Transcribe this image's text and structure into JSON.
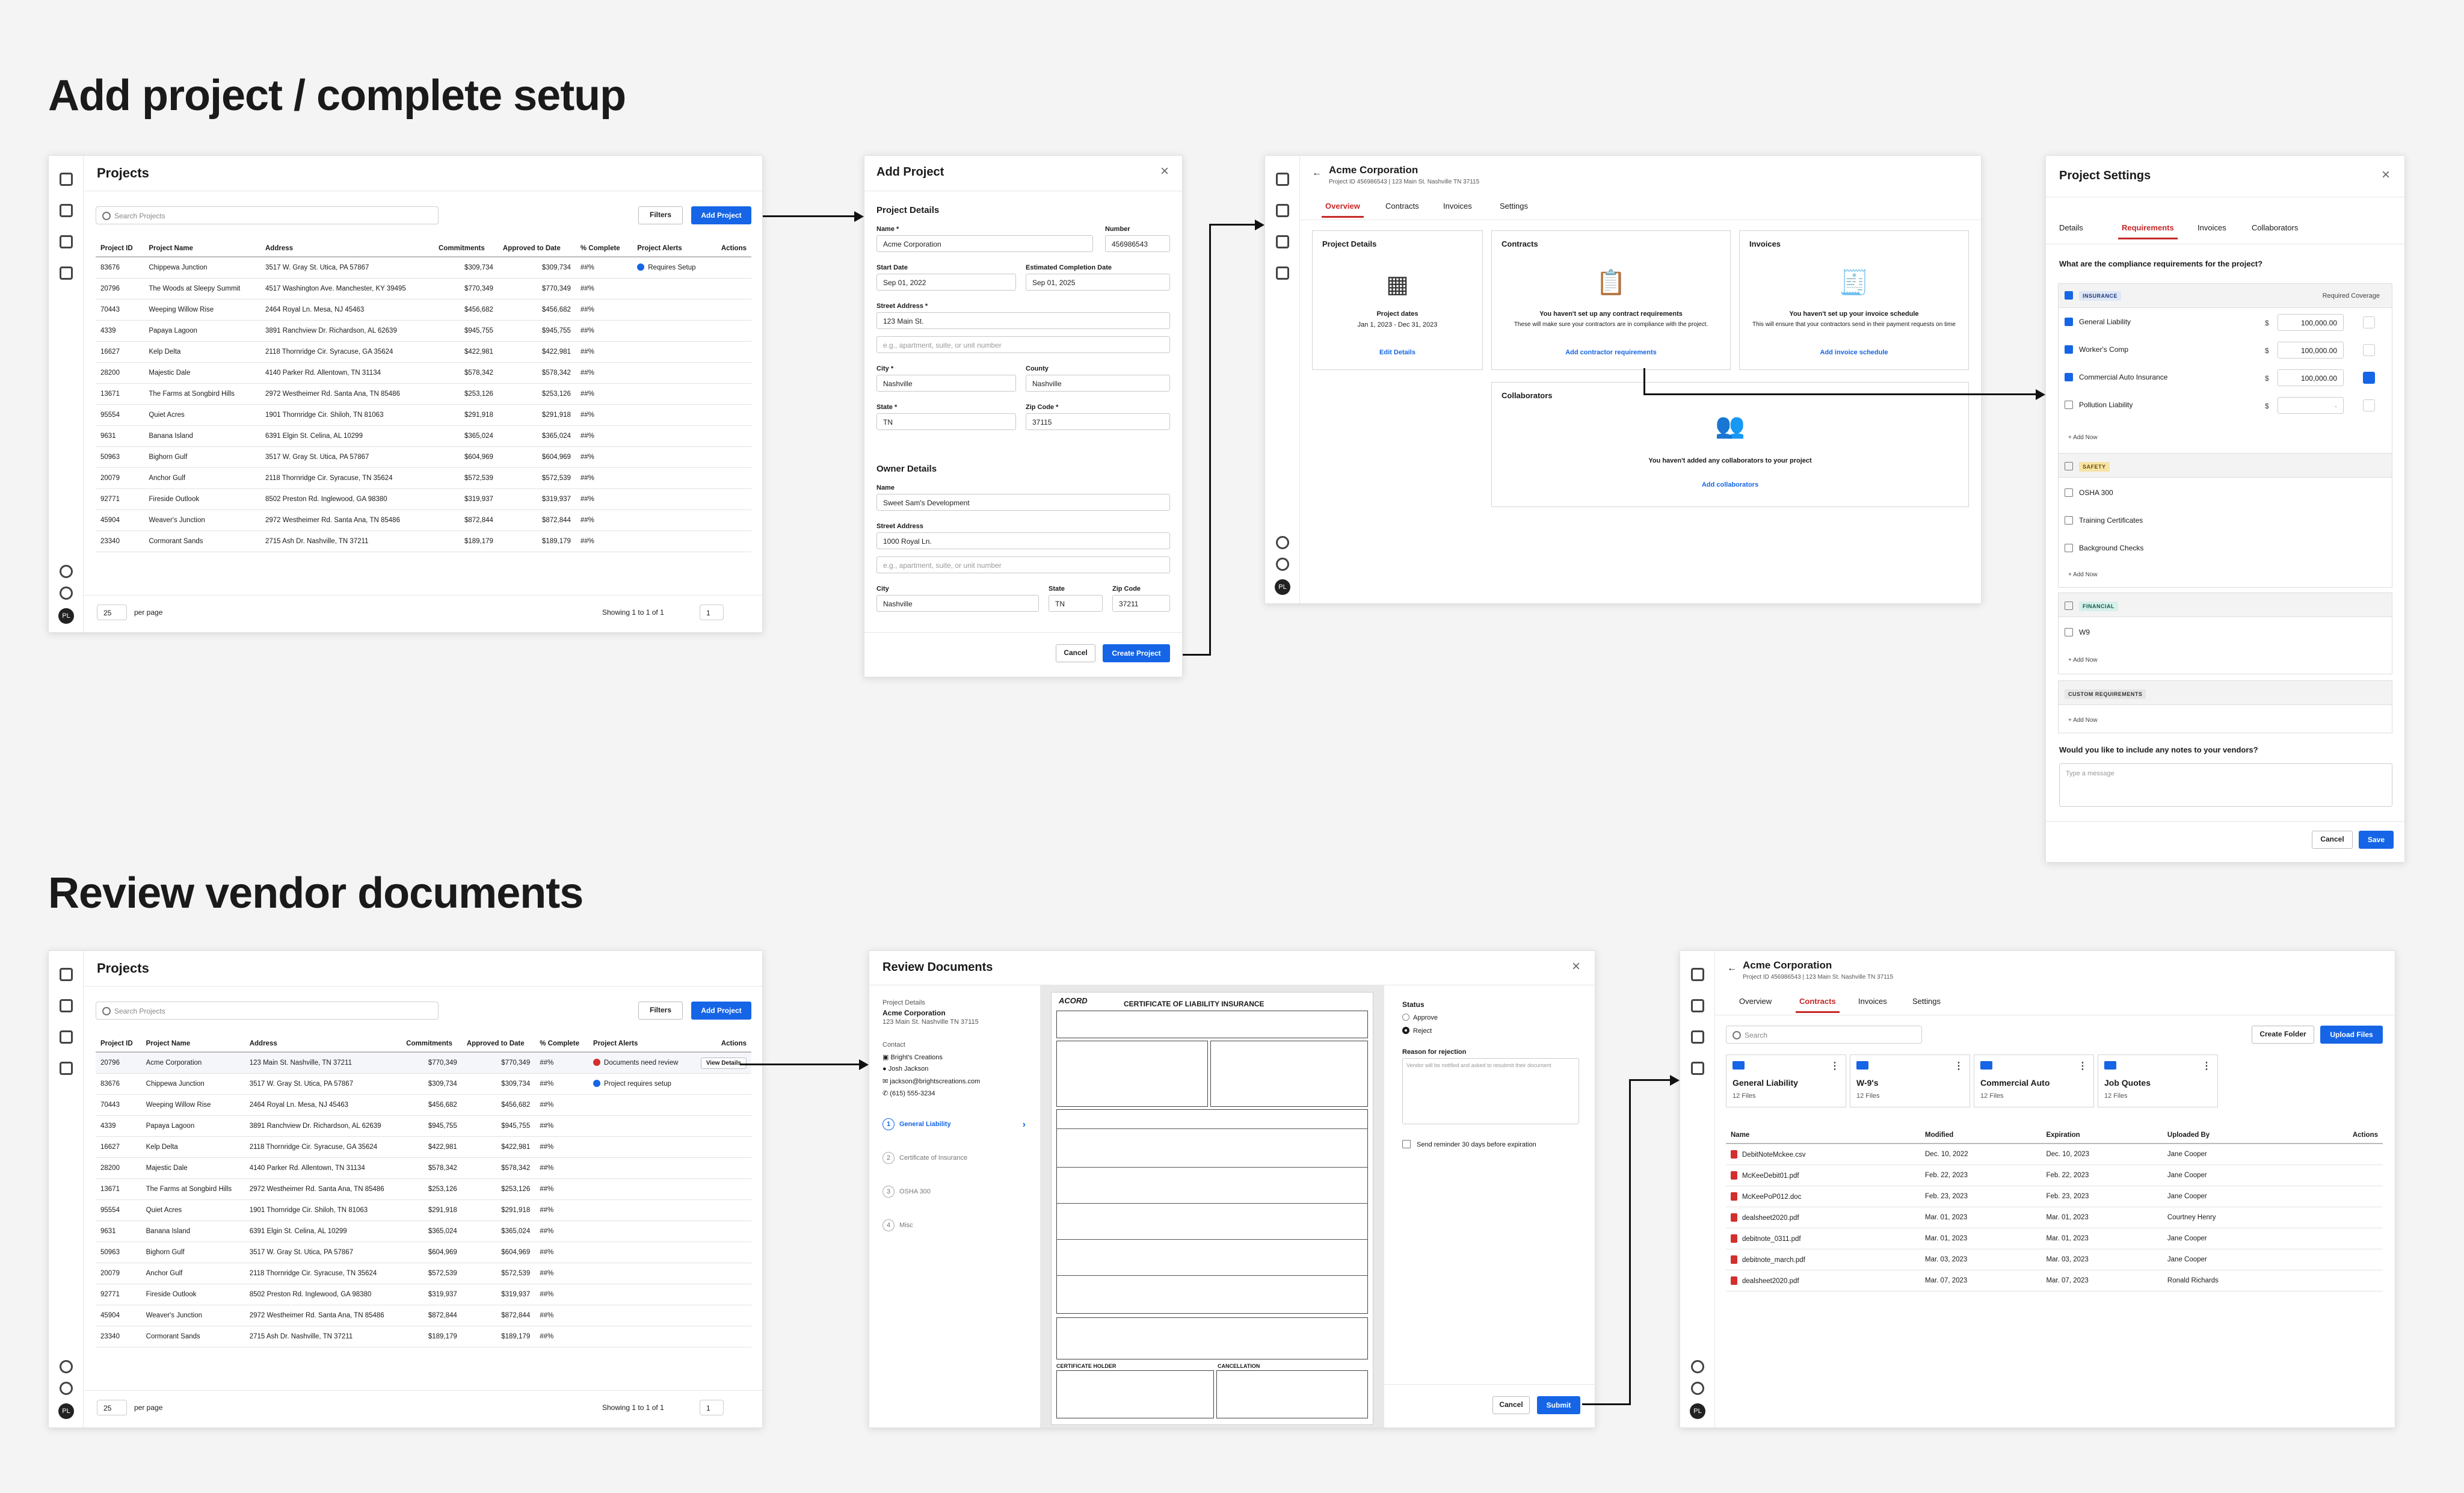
{
  "sections": {
    "setup_title": "Add project / complete setup",
    "review_title": "Review vendor documents"
  },
  "projects": {
    "title": "Projects",
    "search_placeholder": "Search Projects",
    "filters_label": "Filters",
    "add_label": "Add Project",
    "columns": [
      "Project ID",
      "Project Name",
      "Address",
      "Commitments",
      "Approved to Date",
      "% Complete",
      "Project Alerts",
      "Actions"
    ],
    "rows": [
      [
        "83676",
        "Chippewa Junction",
        "3517 W. Gray St. Utica, PA 57867",
        "$309,734",
        "$309,734",
        "##%",
        "Requires Setup"
      ],
      [
        "20796",
        "The Woods at Sleepy Summit",
        "4517 Washington Ave. Manchester, KY 39495",
        "$770,349",
        "$770,349",
        "##%",
        ""
      ],
      [
        "70443",
        "Weeping Willow Rise",
        "2464 Royal Ln. Mesa, NJ 45463",
        "$456,682",
        "$456,682",
        "##%",
        ""
      ],
      [
        "4339",
        "Papaya Lagoon",
        "3891 Ranchview Dr. Richardson, AL 62639",
        "$945,755",
        "$945,755",
        "##%",
        ""
      ],
      [
        "16627",
        "Kelp Delta",
        "2118 Thornridge Cir. Syracuse, GA 35624",
        "$422,981",
        "$422,981",
        "##%",
        ""
      ],
      [
        "28200",
        "Majestic Dale",
        "4140 Parker Rd. Allentown, TN 31134",
        "$578,342",
        "$578,342",
        "##%",
        ""
      ],
      [
        "13671",
        "The Farms at Songbird Hills",
        "2972 Westheimer Rd. Santa Ana, TN 85486",
        "$253,126",
        "$253,126",
        "##%",
        ""
      ],
      [
        "95554",
        "Quiet Acres",
        "1901 Thornridge Cir. Shiloh, TN 81063",
        "$291,918",
        "$291,918",
        "##%",
        ""
      ],
      [
        "9631",
        "Banana Island",
        "6391 Elgin St. Celina, AL 10299",
        "$365,024",
        "$365,024",
        "##%",
        ""
      ],
      [
        "50963",
        "Bighorn Gulf",
        "3517 W. Gray St. Utica, PA 57867",
        "$604,969",
        "$604,969",
        "##%",
        ""
      ],
      [
        "20079",
        "Anchor Gulf",
        "2118 Thornridge Cir. Syracuse, TN 35624",
        "$572,539",
        "$572,539",
        "##%",
        ""
      ],
      [
        "92771",
        "Fireside Outlook",
        "8502 Preston Rd. Inglewood, GA 98380",
        "$319,937",
        "$319,937",
        "##%",
        ""
      ],
      [
        "45904",
        "Weaver's Junction",
        "2972 Westheimer Rd. Santa Ana, TN 85486",
        "$872,844",
        "$872,844",
        "##%",
        ""
      ],
      [
        "23340",
        "Cormorant Sands",
        "2715 Ash Dr. Nashville, TN 37211",
        "$189,179",
        "$189,179",
        "##%",
        ""
      ]
    ],
    "rows2": [
      [
        "20796",
        "Acme Corporation",
        "123 Main St. Nashville, TN 37211",
        "$770,349",
        "$770,349",
        "##%",
        "Documents need review"
      ],
      [
        "83676",
        "Chippewa Junction",
        "3517 W. Gray St. Utica, PA 57867",
        "$309,734",
        "$309,734",
        "##%",
        "Project requires setup"
      ],
      [
        "70443",
        "Weeping Willow Rise",
        "2464 Royal Ln. Mesa, NJ 45463",
        "$456,682",
        "$456,682",
        "##%",
        ""
      ],
      [
        "4339",
        "Papaya Lagoon",
        "3891 Ranchview Dr. Richardson, AL 62639",
        "$945,755",
        "$945,755",
        "##%",
        ""
      ],
      [
        "16627",
        "Kelp Delta",
        "2118 Thornridge Cir. Syracuse, GA 35624",
        "$422,981",
        "$422,981",
        "##%",
        ""
      ],
      [
        "28200",
        "Majestic Dale",
        "4140 Parker Rd. Allentown, TN 31134",
        "$578,342",
        "$578,342",
        "##%",
        ""
      ],
      [
        "13671",
        "The Farms at Songbird Hills",
        "2972 Westheimer Rd. Santa Ana, TN 85486",
        "$253,126",
        "$253,126",
        "##%",
        ""
      ],
      [
        "95554",
        "Quiet Acres",
        "1901 Thornridge Cir. Shiloh, TN 81063",
        "$291,918",
        "$291,918",
        "##%",
        ""
      ],
      [
        "9631",
        "Banana Island",
        "6391 Elgin St. Celina, AL 10299",
        "$365,024",
        "$365,024",
        "##%",
        ""
      ],
      [
        "50963",
        "Bighorn Gulf",
        "3517 W. Gray St. Utica, PA 57867",
        "$604,969",
        "$604,969",
        "##%",
        ""
      ],
      [
        "20079",
        "Anchor Gulf",
        "2118 Thornridge Cir. Syracuse, TN 35624",
        "$572,539",
        "$572,539",
        "##%",
        ""
      ],
      [
        "92771",
        "Fireside Outlook",
        "8502 Preston Rd. Inglewood, GA 98380",
        "$319,937",
        "$319,937",
        "##%",
        ""
      ],
      [
        "45904",
        "Weaver's Junction",
        "2972 Westheimer Rd. Santa Ana, TN 85486",
        "$872,844",
        "$872,844",
        "##%",
        ""
      ],
      [
        "23340",
        "Cormorant Sands",
        "2715 Ash Dr. Nashville, TN 37211",
        "$189,179",
        "$189,179",
        "##%",
        ""
      ]
    ],
    "view_details": "View Details",
    "per_page_value": "25",
    "per_page_label": "per page",
    "showing": "Showing 1 to 1 of 1",
    "page_value": "1",
    "avatar": "PL"
  },
  "add_project": {
    "title": "Add Project",
    "details_title": "Project Details",
    "name_label": "Name *",
    "name_value": "Acme Corporation",
    "number_label": "Number",
    "number_value": "456986543",
    "start_label": "Start Date",
    "start_value": "Sep 01, 2022",
    "end_label": "Estimated Completion Date",
    "end_value": "Sep 01, 2025",
    "street_label": "Street Address *",
    "street_value": "123 Main St.",
    "street2_placeholder": "e.g., apartment, suite, or unit number",
    "city_label": "City *",
    "city_value": "Nashville",
    "county_label": "County",
    "county_value": "Nashville",
    "state_label": "State *",
    "state_value": "TN",
    "zip_label": "Zip Code *",
    "zip_value": "37115",
    "owner_title": "Owner Details",
    "owner_name_label": "Name",
    "owner_name_value": "Sweet Sam's Development",
    "owner_street_label": "Street Address",
    "owner_street_value": "1000 Royal Ln.",
    "owner_street2_placeholder": "e.g., apartment, suite, or unit number",
    "owner_city_label": "City",
    "owner_city_value": "Nashville",
    "owner_state_label": "State",
    "owner_state_value": "TN",
    "owner_zip_label": "Zip Code",
    "owner_zip_value": "37211",
    "cancel": "Cancel",
    "create": "Create Project"
  },
  "overview": {
    "company": "Acme Corporation",
    "subtitle": "Project ID 456986543 | 123 Main St. Nashville TN 37115",
    "tabs": [
      "Overview",
      "Contracts",
      "Invoices",
      "Settings"
    ],
    "project_details": "Project Details",
    "project_dates": "Project dates",
    "dates_value": "Jan 1, 2023 - Dec 31, 2023",
    "edit_details": "Edit Details",
    "contracts": "Contracts",
    "contracts_empty": "You haven't set up any contract requirements",
    "contracts_sub": "These will make sure your contractors are in compliance with the project.",
    "contracts_link": "Add contractor requirements",
    "invoices": "Invoices",
    "invoices_empty": "You haven't set up your invoice schedule",
    "invoices_sub": "This will ensure that your contractors send in their payment requests on time",
    "invoices_link": "Add invoice schedule",
    "collaborators": "Collaborators",
    "collab_empty": "You haven't added any collaborators to your project",
    "collab_link": "Add collaborators"
  },
  "settings": {
    "title": "Project Settings",
    "tabs": [
      "Details",
      "Requirements",
      "Invoices",
      "Collaborators"
    ],
    "question": "What are the compliance requirements for the project?",
    "insurance": "INSURANCE",
    "required_coverage": "Required Coverage",
    "insurance_items": [
      {
        "name": "General Liability",
        "amount": "100,000.00"
      },
      {
        "name": "Worker's Comp",
        "amount": "100,000.00"
      },
      {
        "name": "Commercial Auto Insurance",
        "amount": "100,000.00"
      },
      {
        "name": "Pollution Liability",
        "amount": "-"
      }
    ],
    "add_now": "+ Add Now",
    "safety": "SAFETY",
    "safety_items": [
      "OSHA 300",
      "Training Certificates",
      "Background Checks"
    ],
    "financial": "FINANCIAL",
    "financial_items": [
      "W9"
    ],
    "custom": "CUSTOM REQUIREMENTS",
    "notes_question": "Would you like to include any notes to your vendors?",
    "notes_placeholder": "Type a message",
    "cancel": "Cancel",
    "save": "Save"
  },
  "review": {
    "title": "Review Documents",
    "pd_label": "Project Details",
    "company": "Acme Corporation",
    "address": "123 Main St. Nashville TN 37115",
    "contact_label": "Contact",
    "contact_company": "Bright's Creations",
    "contact_name": "Josh Jackson",
    "contact_email": "jackson@brightscreations.com",
    "contact_phone": "(615) 555-3234",
    "steps": [
      "General Liability",
      "Certificate of Insurance",
      "OSHA 300",
      "Misc"
    ],
    "step_nums": [
      "1",
      "2",
      "3",
      "4"
    ],
    "doc_title": "CERTIFICATE OF LIABILITY INSURANCE",
    "doc_logo": "ACORD",
    "doc_holder": "CERTIFICATE HOLDER",
    "doc_cancel": "CANCELLATION",
    "status": "Status",
    "approve": "Approve",
    "reject": "Reject",
    "reason_label": "Reason for rejection",
    "reason_placeholder": "Vendor will be notified and asked to resubmit their document",
    "reminder": "Send reminder 30 days before expiration",
    "cancel": "Cancel",
    "submit": "Submit"
  },
  "contracts": {
    "company": "Acme Corporation",
    "subtitle": "Project ID 456986543 | 123 Main St. Nashville TN 37115",
    "tabs": [
      "Overview",
      "Contracts",
      "Invoices",
      "Settings"
    ],
    "search_placeholder": "Search",
    "create_folder": "Create Folder",
    "upload": "Upload Files",
    "folders": [
      {
        "name": "General Liability",
        "count": "12 Files"
      },
      {
        "name": "W-9's",
        "count": "12 Files"
      },
      {
        "name": "Commercial Auto",
        "count": "12 Files"
      },
      {
        "name": "Job Quotes",
        "count": "12 Files"
      }
    ],
    "columns": [
      "Name",
      "Modified",
      "Expiration",
      "Uploaded By",
      "Actions"
    ],
    "files": [
      [
        "DebitNoteMckee.csv",
        "Dec. 10, 2022",
        "Dec. 10, 2023",
        "Jane Cooper"
      ],
      [
        "McKeeDebit01.pdf",
        "Feb. 22, 2023",
        "Feb. 22, 2023",
        "Jane Cooper"
      ],
      [
        "McKeePoP012.doc",
        "Feb. 23, 2023",
        "Feb. 23, 2023",
        "Jane Cooper"
      ],
      [
        "dealsheet2020.pdf",
        "Mar. 01, 2023",
        "Mar. 01, 2023",
        "Courtney Henry"
      ],
      [
        "debitnote_0311.pdf",
        "Mar. 01, 2023",
        "Mar. 01, 2023",
        "Jane Cooper"
      ],
      [
        "debitnote_march.pdf",
        "Mar. 03, 2023",
        "Mar. 03, 2023",
        "Jane Cooper"
      ],
      [
        "dealsheet2020.pdf",
        "Mar. 07, 2023",
        "Mar. 07, 2023",
        "Ronald Richards"
      ]
    ]
  },
  "colors": {
    "accent": "#1565e6",
    "active_tab": "#c62828",
    "alert_blue": "#1565e6",
    "alert_red": "#d32f2f"
  }
}
